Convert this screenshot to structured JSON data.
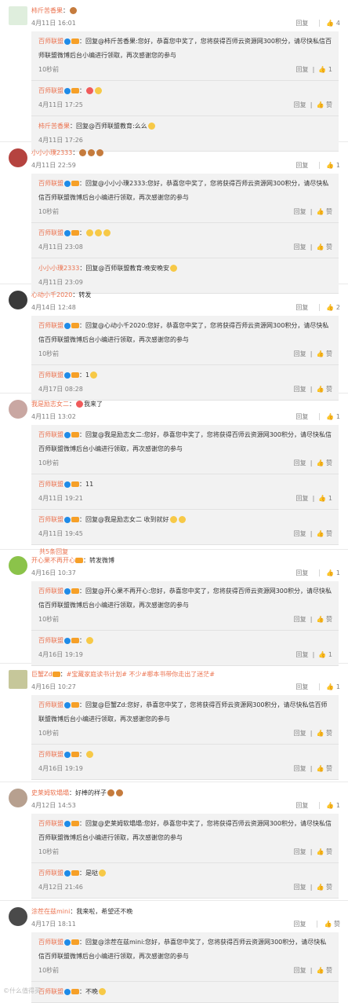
{
  "actions": {
    "reply": "回复",
    "like": "赞"
  },
  "threads": [
    {
      "user": "柿斤苦香果",
      "text": "",
      "time": "4月11日 16:01",
      "likes": "4",
      "replies": [
        {
          "user": "百师联盟",
          "text": "回复@柿斤苦香果:您好，恭喜您中奖了，您将获得百师云资源网300积分，请尽快私信百师联盟微博后台小编进行领取，再次感谢您的参与",
          "time": "10秒前",
          "likes": "1"
        },
        {
          "user": "百师联盟",
          "text": "",
          "time": "4月11日 17:25",
          "likes": "赞"
        },
        {
          "user": "柿斤苦香果",
          "text": "回复@百师联盟教育:么么",
          "time": "4月11日 17:26",
          "likes": "赞"
        }
      ]
    },
    {
      "user": "小小小璞2333",
      "text": "",
      "time": "4月11日 22:59",
      "likes": "1",
      "replies": [
        {
          "user": "百师联盟",
          "text": "回复@小小小璞2333:您好，恭喜您中奖了，您将获得百师云资源网300积分，请尽快私信百师联盟微博后台小编进行领取，再次感谢您的参与",
          "time": "10秒前",
          "likes": "赞"
        },
        {
          "user": "百师联盟",
          "text": "",
          "time": "4月11日 23:08",
          "likes": "赞"
        },
        {
          "user": "小小小璞2333",
          "text": "回复@百师联盟教育:晚安晚安",
          "time": "4月11日 23:09",
          "likes": "赞"
        }
      ]
    },
    {
      "user": "心动小千2020",
      "text": "转发",
      "time": "4月14日 12:48",
      "likes": "2",
      "replies": [
        {
          "user": "百师联盟",
          "text": "回复@心动小千2020:您好，恭喜您中奖了，您将获得百师云资源网300积分，请尽快私信百师联盟微博后台小编进行领取，再次感谢您的参与",
          "time": "10秒前",
          "likes": "赞"
        },
        {
          "user": "百师联盟",
          "text": "1",
          "time": "4月17日 08:28",
          "likes": "赞"
        }
      ]
    },
    {
      "user": "我是励志女二",
      "text": "我来了",
      "time": "4月11日 13:02",
      "likes": "1",
      "replies": [
        {
          "user": "百师联盟",
          "text": "回复@我是励志女二:您好，恭喜您中奖了，您将获得百师云资源网300积分，请尽快私信百师联盟微博后台小编进行领取，再次感谢您的参与",
          "time": "10秒前",
          "likes": "赞"
        },
        {
          "user": "百师联盟",
          "text": "11",
          "time": "4月11日 19:21",
          "likes": "1"
        },
        {
          "user": "百师联盟",
          "text": "回复@我是励志女二 收到就好",
          "time": "4月11日 19:45",
          "likes": "赞"
        }
      ],
      "more": "共5条回复"
    },
    {
      "user": "开心果不再开心",
      "text": "转发微博",
      "time": "4月16日 10:37",
      "likes": "1",
      "replies": [
        {
          "user": "百师联盟",
          "text": "回复@开心果不再开心:您好，恭喜您中奖了，您将获得百师云资源网300积分，请尽快私信百师联盟微博后台小编进行领取，再次感谢您的参与",
          "time": "10秒前",
          "likes": "赞"
        },
        {
          "user": "百师联盟",
          "text": "",
          "time": "4月16日 19:19",
          "likes": "1"
        }
      ]
    },
    {
      "user": "巨蟹Zd",
      "text": "#宝藏家庭读书计划# 不少#哪本书带你走出了迷茫#",
      "time": "4月16日 10:27",
      "likes": "1",
      "replies": [
        {
          "user": "百师联盟",
          "text": "回复@巨蟹Zd:您好，恭喜您中奖了，您将获得百师云资源网300积分，请尽快私信百师联盟微博后台小编进行领取，再次感谢您的参与",
          "time": "10秒前",
          "likes": "赞"
        },
        {
          "user": "百师联盟",
          "text": "",
          "time": "4月16日 19:19",
          "likes": "赞"
        }
      ]
    },
    {
      "user": "史莱姆软塌塌",
      "text": "好棒的样子",
      "time": "4月12日 14:53",
      "likes": "1",
      "replies": [
        {
          "user": "百师联盟",
          "text": "回复@史莱姆软塌塌:您好，恭喜您中奖了，您将获得百师云资源网300积分，请尽快私信百师联盟微博后台小编进行领取，再次感谢您的参与",
          "time": "10秒前",
          "likes": "赞"
        },
        {
          "user": "百师联盟",
          "text": "是哒",
          "time": "4月12日 21:46",
          "likes": "赞"
        }
      ]
    },
    {
      "user": "涂茬在兹mini",
      "text": "我来啦，希望还不晚",
      "time": "4月17日 18:11",
      "likes": "赞",
      "replies": [
        {
          "user": "百师联盟",
          "text": "回复@涂茬在兹mini:您好，恭喜您中奖了，您将获得百师云资源网300积分，请尽快私信百师联盟微博后台小编进行领取，再次感谢您的参与",
          "time": "10秒前",
          "likes": "赞"
        },
        {
          "user": "百师联盟",
          "text": "不晚",
          "time": "",
          "likes": ""
        }
      ]
    }
  ],
  "colors": {
    "username": "#eb7350",
    "vip_blue": "#1f8be8",
    "bg_reply": "#f2f2f2"
  },
  "watermark": "©什么值得买"
}
